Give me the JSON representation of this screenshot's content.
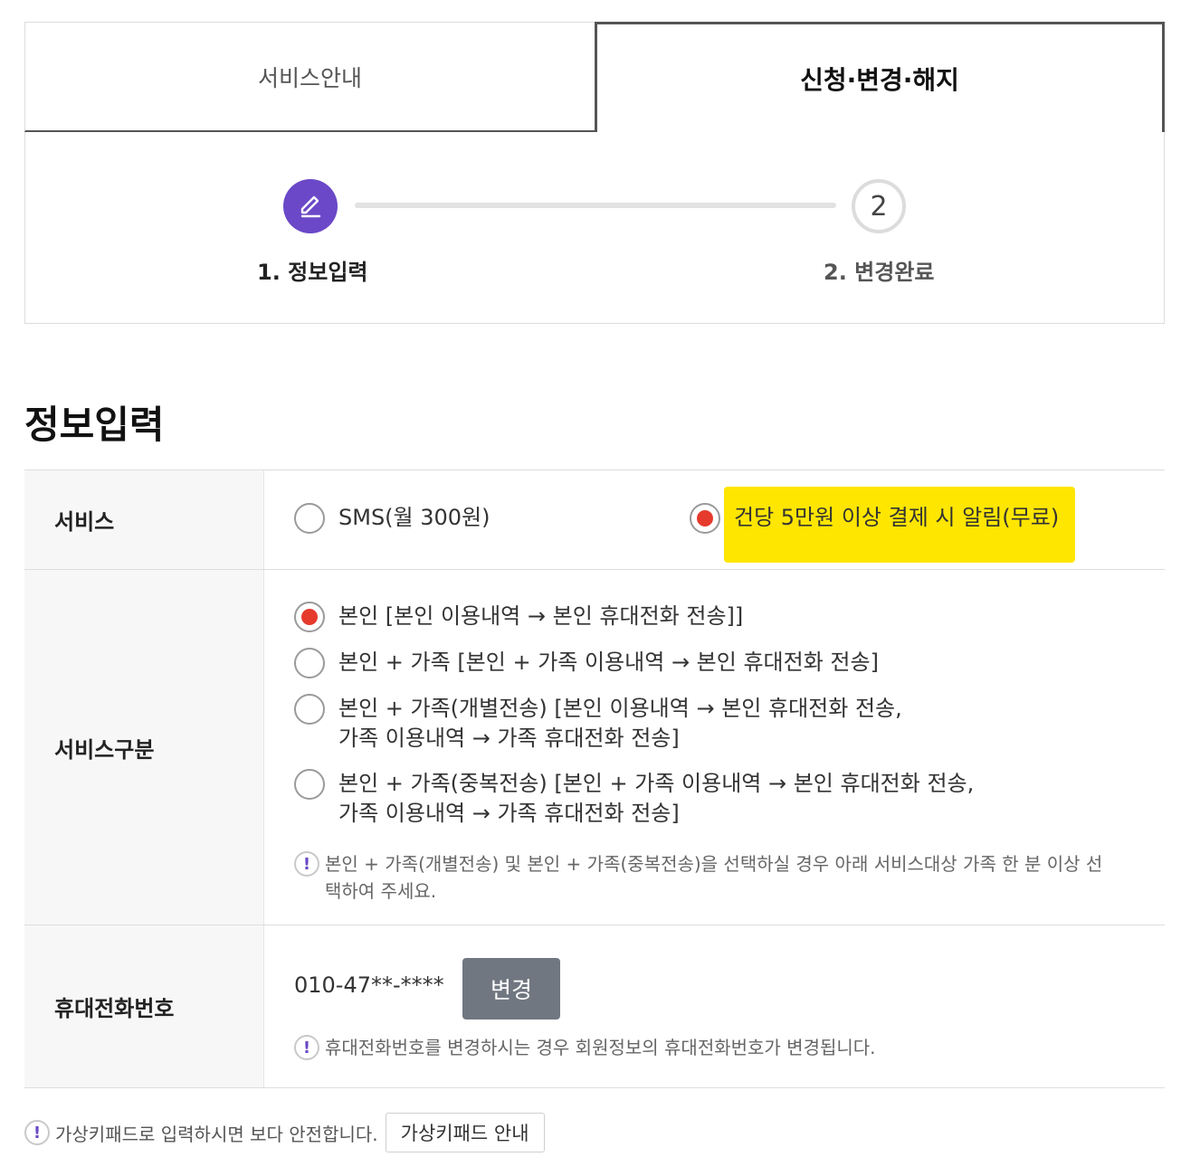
{
  "tabs": {
    "service_info": "서비스안내",
    "apply_change_cancel": "신청·변경·해지"
  },
  "stepper": {
    "step1_label": "1. 정보입력",
    "step2_number": "2",
    "step2_label": "2. 변경완료",
    "active_color": "#6a48c7"
  },
  "section_title": "정보입력",
  "form": {
    "service": {
      "label": "서비스",
      "options": [
        {
          "text": "SMS(월 300원)",
          "checked": false
        },
        {
          "text": "건당 5만원 이상 결제 시 알림(무료)",
          "checked": true
        }
      ]
    },
    "service_kind": {
      "label": "서비스구분",
      "options": [
        {
          "line1": "본인 [본인 이용내역 → 본인 휴대전화 전송]]",
          "line2": "",
          "checked": true
        },
        {
          "line1": "본인 + 가족 [본인 + 가족 이용내역 → 본인 휴대전화 전송]",
          "line2": "",
          "checked": false
        },
        {
          "line1": "본인 + 가족(개별전송) [본인 이용내역 → 본인 휴대전화 전송,",
          "line2": "가족 이용내역 → 가족 휴대전화 전송]",
          "checked": false
        },
        {
          "line1": "본인 + 가족(중복전송) [본인 + 가족 이용내역 → 본인 휴대전화 전송,",
          "line2": "가족 이용내역 → 가족 휴대전화 전송]",
          "checked": false
        }
      ],
      "note_line1": "본인 + 가족(개별전송) 및 본인 + 가족(중복전송)을 선택하실 경우 아래 서비스대상 가족 한 분 이상 선",
      "note_line2": "택하여 주세요."
    },
    "phone": {
      "label": "휴대전화번호",
      "value": "010-47**-****",
      "change_button": "변경",
      "note": "휴대전화번호를 변경하시는 경우 회원정보의 휴대전화번호가 변경됩니다."
    }
  },
  "bottom": {
    "note": "가상키패드로 입력하시면 보다 안전합니다.",
    "keypad_button": "가상키패드 안내"
  },
  "icons": {
    "note_icon_glyph": "!"
  },
  "colors": {
    "highlight": "#ffe600",
    "radio_checked": "#e53a2c",
    "button_bg": "#707781"
  }
}
